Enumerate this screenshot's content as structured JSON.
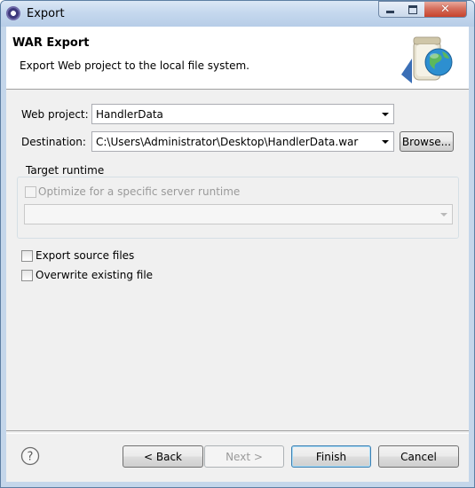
{
  "window": {
    "title": "Export"
  },
  "header": {
    "title": "WAR Export",
    "description": "Export Web project to the local file system.",
    "icon": "war-archive-globe-icon"
  },
  "form": {
    "web_project": {
      "label": "Web project:",
      "value": "HandlerData"
    },
    "destination": {
      "label": "Destination:",
      "value": "C:\\Users\\Administrator\\Desktop\\HandlerData.war",
      "browse_label": "Browse..."
    },
    "target_runtime": {
      "title": "Target runtime",
      "optimize_label": "Optimize for a specific server runtime",
      "optimize_checked": false,
      "runtime_value": ""
    },
    "export_source": {
      "label": "Export source files",
      "checked": false
    },
    "overwrite": {
      "label": "Overwrite existing file",
      "checked": false
    }
  },
  "buttons": {
    "back": "< Back",
    "next": "Next >",
    "finish": "Finish",
    "cancel": "Cancel"
  },
  "colors": {
    "title_bar": "#c4d6ea",
    "close_button": "#c7432c",
    "default_button_border": "#3c7fb1"
  }
}
